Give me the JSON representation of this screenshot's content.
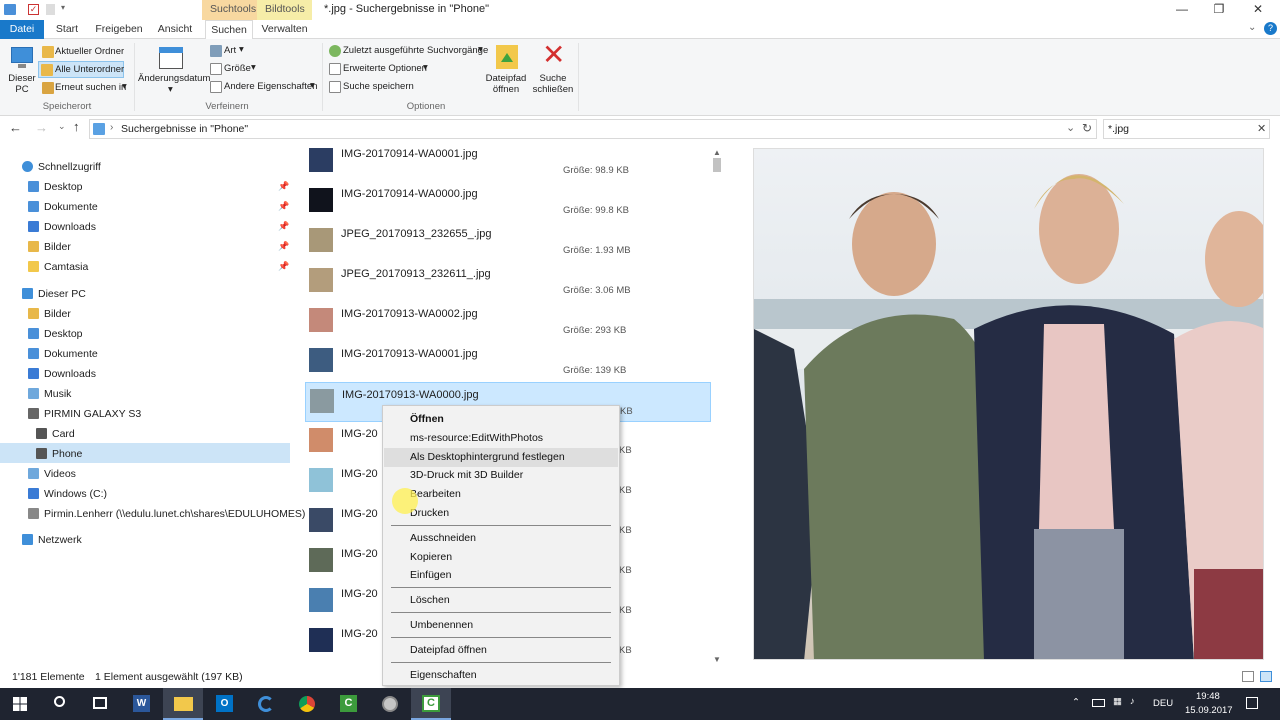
{
  "window": {
    "title": "*.jpg - Suchergebnisse in \"Phone\"",
    "context_groups": [
      "Suchtools",
      "Bildtools"
    ],
    "controls": {
      "minimize": "—",
      "maximize": "❐",
      "close": "✕"
    }
  },
  "tabs": {
    "datei": "Datei",
    "start": "Start",
    "freigeben": "Freigeben",
    "ansicht": "Ansicht",
    "suchen": "Suchen",
    "verwalten": "Verwalten"
  },
  "ribbon": {
    "speicherort": {
      "dieser_pc": "Dieser PC",
      "aktueller_ordner": "Aktueller Ordner",
      "alle_unterordner": "Alle Unterordner",
      "erneut_suchen": "Erneut suchen in",
      "label": "Speicherort"
    },
    "verfeinern": {
      "aenderungsdatum": "Änderungsdatum",
      "art": "Art",
      "groesse": "Größe",
      "andere_eigenschaften": "Andere Eigenschaften",
      "label": "Verfeinern"
    },
    "optionen": {
      "zuletzt": "Zuletzt ausgeführte Suchvorgänge",
      "erweitert": "Erweiterte Optionen",
      "suche_speichern": "Suche speichern",
      "dateipfad_oeffnen": "Dateipfad öffnen",
      "suche_schliessen": "Suche schließen",
      "label": "Optionen"
    }
  },
  "address": {
    "path": "Suchergebnisse in \"Phone\"",
    "search_value": "*.jpg"
  },
  "nav": {
    "schnellzugriff": "Schnellzugriff",
    "quick": [
      {
        "label": "Desktop",
        "color": "#4a90d9"
      },
      {
        "label": "Dokumente",
        "color": "#4a90d9"
      },
      {
        "label": "Downloads",
        "color": "#3a7bd5"
      },
      {
        "label": "Bilder",
        "color": "#e8b84a"
      },
      {
        "label": "Camtasia",
        "color": "#f2c84b"
      }
    ],
    "dieser_pc": "Dieser PC",
    "pc": [
      {
        "label": "Bilder",
        "color": "#e8b84a",
        "indent": 0
      },
      {
        "label": "Desktop",
        "color": "#4a90d9",
        "indent": 0
      },
      {
        "label": "Dokumente",
        "color": "#4a90d9",
        "indent": 0
      },
      {
        "label": "Downloads",
        "color": "#3a7bd5",
        "indent": 0
      },
      {
        "label": "Musik",
        "color": "#6fa8dc",
        "indent": 0
      },
      {
        "label": "PIRMIN GALAXY S3",
        "color": "#666666",
        "indent": 0
      },
      {
        "label": "Card",
        "color": "#555555",
        "indent": 1
      },
      {
        "label": "Phone",
        "color": "#555555",
        "indent": 1
      },
      {
        "label": "Videos",
        "color": "#6fa8dc",
        "indent": 0
      },
      {
        "label": "Windows (C:)",
        "color": "#3a7bd5",
        "indent": 0
      },
      {
        "label": "Pirmin.Lenherr (\\\\edulu.lunet.ch\\shares\\EDULUHOMES) (",
        "color": "#888888",
        "indent": 0
      }
    ],
    "netzwerk": "Netzwerk"
  },
  "files": [
    {
      "name": "IMG-20170914-WA0001.jpg",
      "size_label": "Größe:",
      "size": "98.9 KB",
      "thumb": "#2b3d62"
    },
    {
      "name": "IMG-20170914-WA0000.jpg",
      "size_label": "Größe:",
      "size": "99.8 KB",
      "thumb": "#10131c"
    },
    {
      "name": "JPEG_20170913_232655_.jpg",
      "size_label": "Größe:",
      "size": "1.93 MB",
      "thumb": "#a89878"
    },
    {
      "name": "JPEG_20170913_232611_.jpg",
      "size_label": "Größe:",
      "size": "3.06 MB",
      "thumb": "#b39d7c"
    },
    {
      "name": "IMG-20170913-WA0002.jpg",
      "size_label": "Größe:",
      "size": "293 KB",
      "thumb": "#c4897a"
    },
    {
      "name": "IMG-20170913-WA0001.jpg",
      "size_label": "Größe:",
      "size": "139 KB",
      "thumb": "#3d5c80"
    },
    {
      "name": "IMG-20170913-WA0000.jpg",
      "size_label": "",
      "size": "KB",
      "thumb": "#8a9aa0"
    },
    {
      "name": "IMG-20",
      "size_label": "",
      "size": "KB",
      "thumb": "#d08c6a"
    },
    {
      "name": "IMG-20",
      "size_label": "",
      "size": "KB",
      "thumb": "#8fc2d8"
    },
    {
      "name": "IMG-20",
      "size_label": "",
      "size": "KB",
      "thumb": "#3a4a66"
    },
    {
      "name": "IMG-20",
      "size_label": "",
      "size": "KB",
      "thumb": "#5e6a58"
    },
    {
      "name": "IMG-20",
      "size_label": "",
      "size": "KB",
      "thumb": "#4a7fb0"
    },
    {
      "name": "IMG-20",
      "size_label": "",
      "size": "KB",
      "thumb": "#1f2f55"
    }
  ],
  "context_menu": [
    {
      "type": "item",
      "label": "Öffnen",
      "bold": true
    },
    {
      "type": "item",
      "label": "ms-resource:EditWithPhotos"
    },
    {
      "type": "item",
      "label": "Als Desktophintergrund festlegen",
      "highlight": true
    },
    {
      "type": "item",
      "label": "3D-Druck mit 3D Builder"
    },
    {
      "type": "item",
      "label": "Bearbeiten"
    },
    {
      "type": "item",
      "label": "Drucken"
    },
    {
      "type": "sep"
    },
    {
      "type": "item",
      "label": "Ausschneiden"
    },
    {
      "type": "item",
      "label": "Kopieren"
    },
    {
      "type": "item",
      "label": "Einfügen"
    },
    {
      "type": "sep"
    },
    {
      "type": "item",
      "label": "Löschen"
    },
    {
      "type": "sep"
    },
    {
      "type": "item",
      "label": "Umbenennen"
    },
    {
      "type": "sep"
    },
    {
      "type": "item",
      "label": "Dateipfad öffnen"
    },
    {
      "type": "sep"
    },
    {
      "type": "item",
      "label": "Eigenschaften"
    }
  ],
  "status": {
    "count": "1'181 Elemente",
    "selection": "1 Element ausgewählt (197 KB)"
  },
  "taskbar": {
    "language": "DEU",
    "time": "19:48",
    "date": "15.09.2017"
  }
}
